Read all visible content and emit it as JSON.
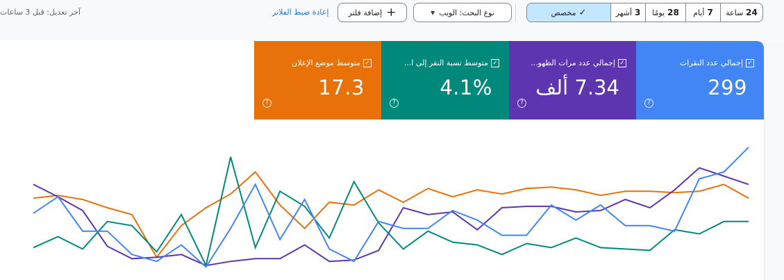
{
  "toolbar": {
    "last_modified": "آخر تعديل: قبل 3 ساعات",
    "reset_filters": "إعادة ضبط الفلاتر",
    "add_filter": "إضافة فلتر",
    "search_type": "نوع البحث: الويب",
    "date_range": {
      "selected": "custom",
      "options": [
        {
          "num": "24",
          "unit": "ساعة"
        },
        {
          "num": "7",
          "unit": "أيام"
        },
        {
          "num": "28",
          "unit": "يومًا"
        },
        {
          "num": "3",
          "unit": "أشهر"
        },
        {
          "num": "",
          "unit": "مخصص"
        }
      ]
    }
  },
  "metrics": [
    {
      "label": "إجمالي عدد النقرات",
      "value": "299",
      "color": "#4285f4",
      "checked": true
    },
    {
      "label": "إجمالي عدد مرات الظهو...",
      "value": "7.34 ألف",
      "color": "#5e35b1",
      "checked": true
    },
    {
      "label": "متوسط نسبة النقر إلى ا...",
      "value": "4.1%",
      "color": "#00897b",
      "checked": true
    },
    {
      "label": "متوسط موضع الإعلان",
      "value": "17.3",
      "color": "#e8710a",
      "checked": true
    }
  ],
  "chart_data": {
    "type": "line",
    "x": [
      1,
      2,
      3,
      4,
      5,
      6,
      7,
      8,
      9,
      10,
      11,
      12,
      13,
      14,
      15,
      16,
      17,
      18,
      19,
      20,
      21,
      22,
      23,
      24,
      25,
      26,
      27,
      28,
      29,
      30
    ],
    "ylim": [
      0,
      100
    ],
    "series": [
      {
        "color": "#4285f4",
        "values": [
          47,
          59,
          34,
          34,
          17,
          12,
          24,
          8,
          36,
          68,
          28,
          57,
          21,
          12,
          41,
          36,
          36,
          49,
          42,
          31,
          31,
          53,
          42,
          53,
          38,
          38,
          34,
          72,
          77,
          95
        ]
      },
      {
        "color": "#5e35b1",
        "values": [
          68,
          59,
          49,
          23,
          14,
          15,
          17,
          9,
          12,
          14,
          14,
          24,
          12,
          13,
          20,
          51,
          46,
          48,
          35,
          51,
          52,
          52,
          48,
          49,
          57,
          51,
          64,
          80,
          74,
          68
        ]
      },
      {
        "color": "#00897b",
        "values": [
          22,
          30,
          21,
          41,
          38,
          19,
          46,
          9,
          88,
          22,
          63,
          52,
          29,
          70,
          40,
          21,
          34,
          26,
          24,
          17,
          25,
          22,
          29,
          22,
          21,
          20,
          35,
          32,
          41,
          41
        ]
      },
      {
        "color": "#e8710a",
        "values": [
          58,
          60,
          57,
          51,
          46,
          15,
          38,
          51,
          61,
          77,
          53,
          36,
          55,
          53,
          64,
          55,
          65,
          59,
          64,
          61,
          65,
          66,
          64,
          60,
          63,
          63,
          62,
          63,
          68,
          58
        ]
      }
    ]
  }
}
